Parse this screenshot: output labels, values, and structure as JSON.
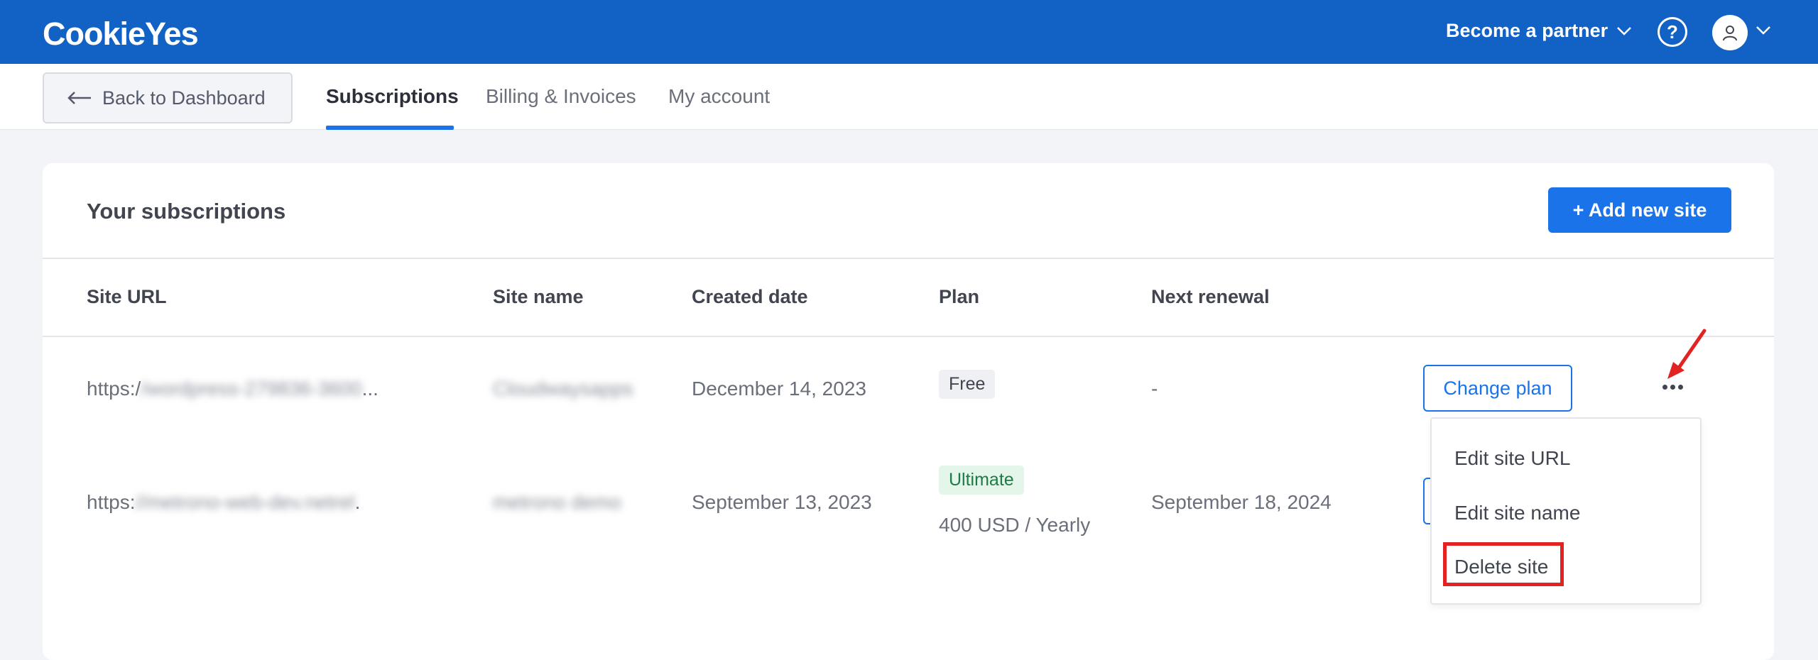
{
  "header": {
    "logo": "CookieYes",
    "partner_label": "Become a partner",
    "help_label": "?"
  },
  "nav": {
    "back_label": "Back to Dashboard",
    "tabs": [
      {
        "label": "Subscriptions",
        "active": true
      },
      {
        "label": "Billing & Invoices",
        "active": false
      },
      {
        "label": "My account",
        "active": false
      }
    ]
  },
  "card": {
    "title": "Your subscriptions",
    "add_button": "+ Add new site"
  },
  "table": {
    "columns": [
      "Site URL",
      "Site name",
      "Created date",
      "Plan",
      "Next renewal"
    ],
    "rows": [
      {
        "url_prefix": "https:/",
        "url_blurred": "/wordpress-279836-3600",
        "url_suffix": "...",
        "site_name": "Cloudwaysapps",
        "created": "December 14, 2023",
        "plan": "Free",
        "plan_price": "",
        "renewal": "-",
        "action": "Change plan"
      },
      {
        "url_prefix": "https:",
        "url_blurred": "//metrono-web-dev.netrel",
        "url_suffix": ".",
        "site_name": "metrono demo",
        "created": "September 13, 2023",
        "plan": "Ultimate",
        "plan_price": "400 USD / Yearly",
        "renewal": "September 18, 2024",
        "action": ""
      }
    ]
  },
  "menu": {
    "items": [
      "Edit site URL",
      "Edit site name",
      "Delete site"
    ]
  },
  "colors": {
    "brand_blue": "#1262c6",
    "accent": "#1a73e8",
    "highlight": "#e32222"
  }
}
